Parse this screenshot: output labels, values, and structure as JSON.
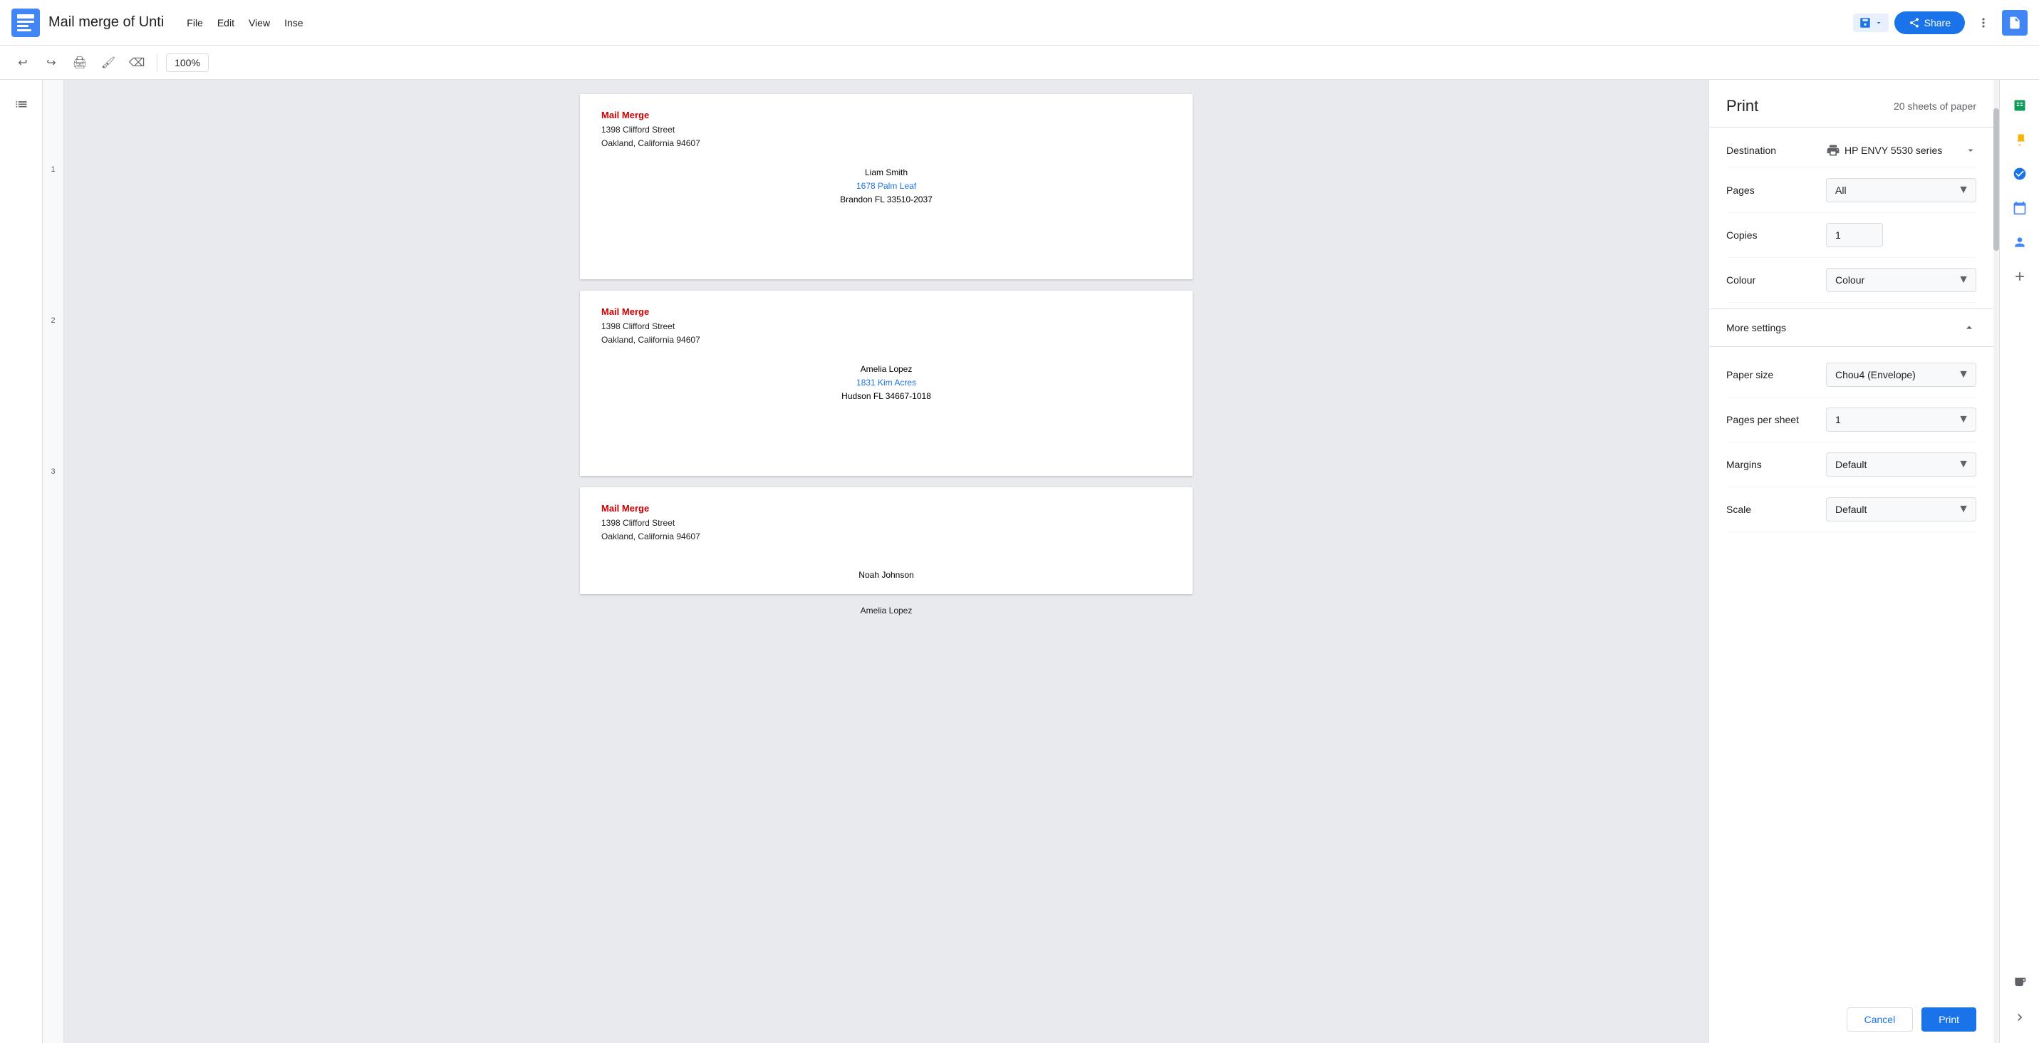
{
  "topbar": {
    "app_icon_label": "Google Docs",
    "title": "Mail merge of Unti",
    "menu": [
      "File",
      "Edit",
      "View",
      "Inse"
    ],
    "share_label": "Share",
    "zoom": "100%"
  },
  "toolbar": {
    "undo_label": "↩",
    "redo_label": "↪",
    "print_label": "🖨",
    "paint_format": "🖌",
    "clear_format": "⌫"
  },
  "envelopes": [
    {
      "sender_name": "Mail Merge",
      "sender_line1": "1398 Clifford Street",
      "sender_line2": "Oakland, California 94607",
      "recipient_name": "Liam Smith",
      "recipient_line1": "1678 Palm Leaf",
      "recipient_line2": "Brandon FL 33510-2037"
    },
    {
      "sender_name": "Mail Merge",
      "sender_line1": "1398 Clifford Street",
      "sender_line2": "Oakland, California 94607",
      "recipient_name": "Amelia Lopez",
      "recipient_line1": "1831 Kim Acres",
      "recipient_line2": "Hudson FL 34667-1018"
    },
    {
      "sender_name": "Mail Merge",
      "sender_line1": "1398 Clifford Street",
      "sender_line2": "Oakland, California 94607",
      "recipient_name": "Noah Johnson",
      "recipient_line1": "",
      "recipient_line2": ""
    }
  ],
  "footer_recipient": "Amelia Lopez",
  "print": {
    "title": "Print",
    "sheets_count": "20 sheets of paper",
    "destination_label": "Destination",
    "destination_value": "HP ENVY 5530 series",
    "pages_label": "Pages",
    "pages_value": "All",
    "copies_label": "Copies",
    "copies_value": "1",
    "colour_label": "Colour",
    "colour_value": "Colour",
    "more_settings_label": "More settings",
    "paper_size_label": "Paper size",
    "paper_size_value": "Chou4 (Envelope)",
    "pages_per_sheet_label": "Pages per sheet",
    "pages_per_sheet_value": "1",
    "margins_label": "Margins",
    "margins_value": "Default",
    "scale_label": "Scale",
    "scale_value": "Default",
    "cancel_label": "Cancel",
    "print_label": "Print"
  },
  "right_sidebar": {
    "sheets_icon": "📊",
    "keep_icon": "💛",
    "tasks_icon": "✓",
    "calendar_icon": "📅",
    "contacts_icon": "👤",
    "add_icon": "+"
  },
  "page_numbers": [
    "1",
    "2",
    "3"
  ]
}
